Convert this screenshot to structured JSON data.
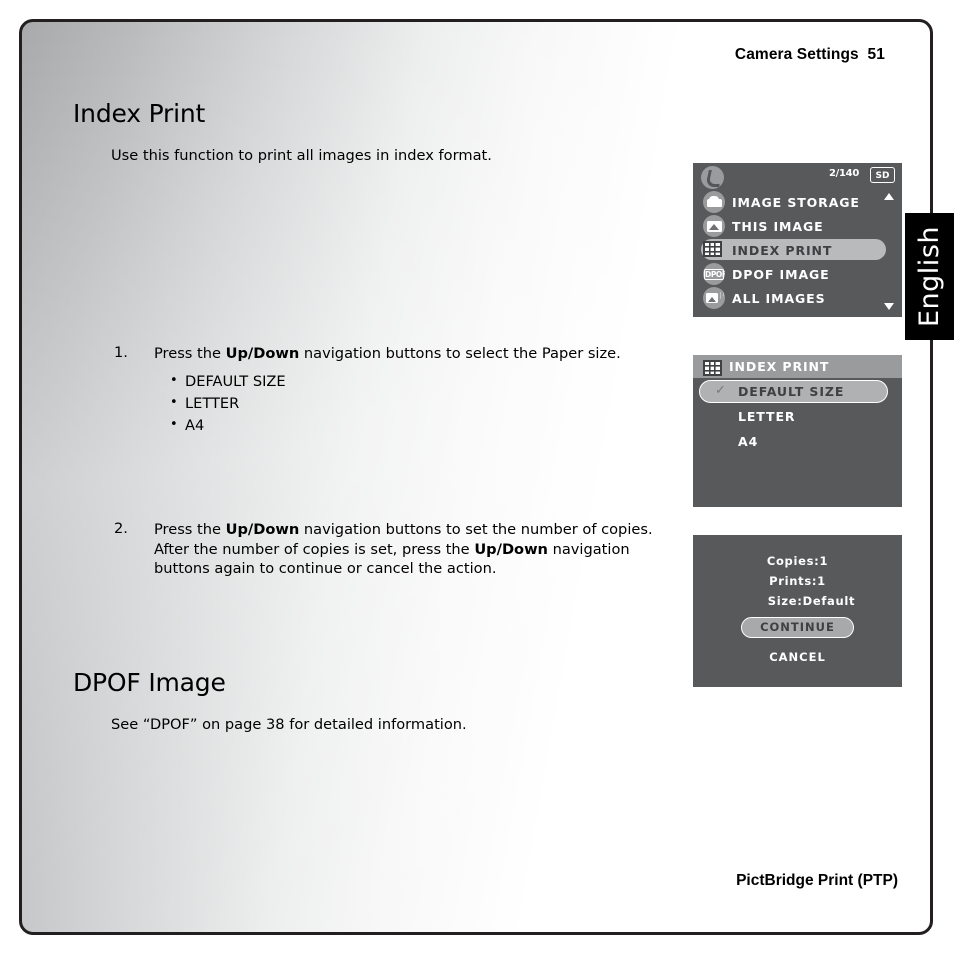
{
  "header": {
    "running_head": "Camera Settings  51"
  },
  "footer": {
    "label": "PictBridge Print (PTP)"
  },
  "side_tab": {
    "label": "English"
  },
  "sections": [
    {
      "heading": "Index Print",
      "intro": "Use this function to print all images in index format."
    },
    {
      "heading": "DPOF Image",
      "intro": "See “DPOF” on page 38 for detailed information."
    }
  ],
  "content": {
    "heading_index_print": "Index Print",
    "intro_index_print": "Use this function to print all images in index format.",
    "heading_dpof_image": "DPOF Image",
    "intro_dpof_image": "See “DPOF” on page 38 for detailed information."
  },
  "steps": [
    {
      "number": "1.",
      "text_before": "Press the ",
      "bold": "Up/Down",
      "text_after": " navigation buttons to select the Paper size.",
      "bullets": [
        "DEFAULT SIZE",
        "LETTER",
        "A4"
      ]
    },
    {
      "number": "2.",
      "part1": "Press the ",
      "bold1": "Up/Down",
      "part2": " navigation buttons to set the number of copies. After the number of copies is set, press the ",
      "bold2": "Up/Down",
      "part3": " navigation buttons again to continue or cancel the action.",
      "bullets": []
    }
  ],
  "lcd_menu": {
    "frame_counter": "2/140",
    "card_badge": "SD",
    "items": [
      {
        "label": "IMAGE STORAGE",
        "icon": "folder-icon",
        "selected": false
      },
      {
        "label": "THIS IMAGE",
        "icon": "photo-icon",
        "selected": false
      },
      {
        "label": "INDEX PRINT",
        "icon": "grid-icon",
        "selected": true
      },
      {
        "label": "DPOF IMAGE",
        "icon": "dpof-icon",
        "selected": false
      },
      {
        "label": "ALL IMAGES",
        "icon": "stacked-photos-icon",
        "selected": false
      }
    ],
    "dpof_icon_text": "DPOF"
  },
  "lcd_paper": {
    "title": "INDEX PRINT",
    "options": [
      {
        "label": "DEFAULT SIZE",
        "selected": true,
        "check": "✓"
      },
      {
        "label": "LETTER",
        "selected": false,
        "check": ""
      },
      {
        "label": "A4",
        "selected": false,
        "check": ""
      }
    ]
  },
  "lcd_confirm": {
    "copies": "Copies:1",
    "prints": "Prints:1",
    "size": "Size:Default",
    "continue_label": "CONTINUE",
    "cancel_label": "CANCEL"
  },
  "colors": {
    "lcd_background": "#58595b",
    "lcd_titlebar": "#9a9b9d",
    "lcd_highlight": "#b9babc",
    "page_border": "#231f20",
    "tab_background": "#000000"
  }
}
